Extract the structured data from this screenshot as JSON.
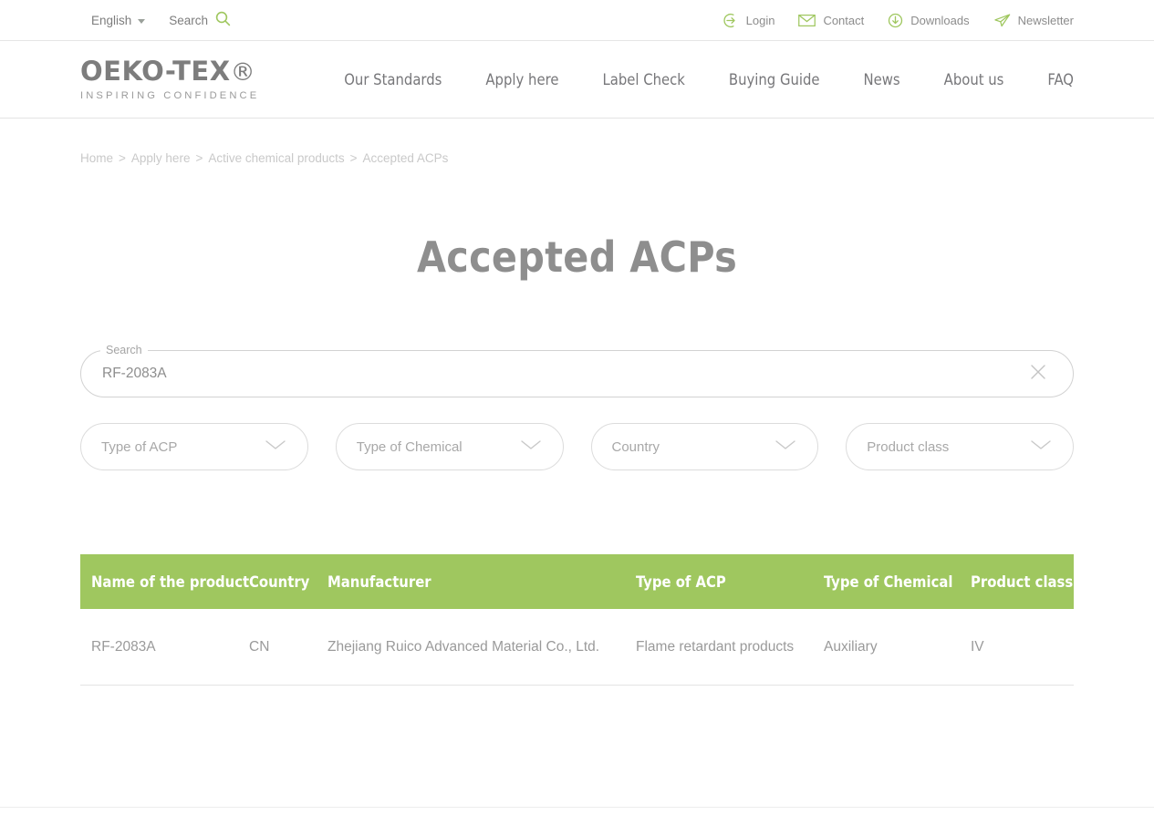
{
  "utility_bar": {
    "language": {
      "label": "English",
      "icon": "chevron-down-icon"
    },
    "search": {
      "label": "Search",
      "icon": "search-icon"
    },
    "links": [
      {
        "label": "Login",
        "icon": "login-icon"
      },
      {
        "label": "Contact",
        "icon": "envelope-icon"
      },
      {
        "label": "Downloads",
        "icon": "download-icon"
      },
      {
        "label": "Newsletter",
        "icon": "paper-plane-icon"
      }
    ]
  },
  "header": {
    "logo": {
      "word": "OEKO-TEX",
      "registered": "®",
      "tagline": "INSPIRING CONFIDENCE"
    },
    "nav": [
      {
        "label": "Our Standards"
      },
      {
        "label": "Apply here"
      },
      {
        "label": "Label Check"
      },
      {
        "label": "Buying Guide"
      },
      {
        "label": "News"
      },
      {
        "label": "About us"
      },
      {
        "label": "FAQ"
      }
    ]
  },
  "breadcrumb": {
    "items": [
      "Home",
      "Apply here",
      "Active chemical products",
      "Accepted ACPs"
    ],
    "separator": ">"
  },
  "page": {
    "title": "Accepted ACPs"
  },
  "search": {
    "label": "Search",
    "value": "RF-2083A",
    "placeholder": "Search",
    "clear_icon": "close-icon"
  },
  "filters": [
    {
      "label": "Type of ACP",
      "icon": "chevron-down-icon"
    },
    {
      "label": "Type of Chemical",
      "icon": "chevron-down-icon"
    },
    {
      "label": "Country",
      "icon": "chevron-down-icon"
    },
    {
      "label": "Product class",
      "icon": "chevron-down-icon"
    }
  ],
  "table": {
    "columns": [
      "Name of the product",
      "Country",
      "Manufacturer",
      "Type of ACP",
      "Type of Chemical",
      "Product class"
    ],
    "rows": [
      {
        "name": "RF-2083A",
        "country": "CN",
        "manufacturer": "Zhejiang Ruico Advanced Material Co., Ltd.",
        "type_of_acp": "Flame retardant products",
        "type_of_chemical": "Auxiliary",
        "product_class": "IV"
      }
    ]
  },
  "colors": {
    "brand_green": "#9fc75f",
    "accent_green": "#a3c964",
    "text_grey": "#8a8a8a",
    "muted_grey": "#c9c9c9"
  }
}
